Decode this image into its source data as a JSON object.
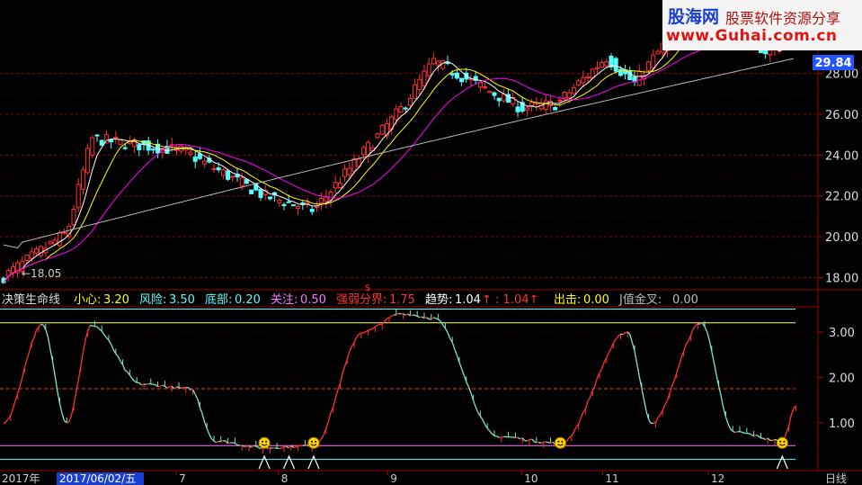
{
  "watermark": {
    "brand": "股海网",
    "tagline": "股票软件资源分享",
    "url": "www.Guhai.com.cn"
  },
  "colors": {
    "up": "#ff3232",
    "down": "#54ffff",
    "ma5": "#ffffff",
    "ma10": "#ffff00",
    "ma20": "#ff00ff",
    "ma60": "#bbbbbb",
    "axis": "#9b0000"
  },
  "chart_data": [
    {
      "type": "candlestick",
      "title": "",
      "last_price_label": "29.84",
      "low_marker_label": "←18.05",
      "y_ticks": [
        "28.00",
        "26.00",
        "24.00",
        "22.00",
        "20.00",
        "18.00"
      ],
      "ylim": [
        17.4,
        31.6
      ],
      "grid": true,
      "series_lines": [
        "ma-short",
        "ma-mid",
        "ma-long"
      ],
      "key_points": [
        {
          "date": "2017-05-15",
          "close": 18.05
        },
        {
          "date": "2017-06-02",
          "close": 20.2
        },
        {
          "date": "2017-06-09",
          "close": 24.8
        },
        {
          "date": "2017-07-05",
          "close": 24.2
        },
        {
          "date": "2017-07-28",
          "close": 22.0
        },
        {
          "date": "2017-08-11",
          "close": 21.3
        },
        {
          "date": "2017-09-05",
          "close": 26.3
        },
        {
          "date": "2017-09-14",
          "close": 28.6
        },
        {
          "date": "2017-10-09",
          "close": 26.3
        },
        {
          "date": "2017-10-19",
          "close": 26.5
        },
        {
          "date": "2017-11-02",
          "close": 28.8
        },
        {
          "date": "2017-11-10",
          "close": 27.5
        },
        {
          "date": "2017-11-24",
          "close": 30.7
        },
        {
          "date": "2017-12-08",
          "close": 30.2
        },
        {
          "date": "2017-12-18",
          "close": 29.0
        },
        {
          "date": "2017-12-26",
          "close": 29.84
        }
      ]
    },
    {
      "type": "line",
      "title": "决策生命线",
      "legend": [
        {
          "label": "小心:",
          "value": "3.20",
          "color": "#ffff00"
        },
        {
          "label": "风险:",
          "value": "3.50",
          "color": "#54ffff"
        },
        {
          "label": "底部:",
          "value": "0.20",
          "color": "#54ffff"
        },
        {
          "label": "关注:",
          "value": "0.50",
          "color": "#ff77ff"
        },
        {
          "label": "强弱分界:",
          "value": "1.75",
          "color": "#ff3232"
        },
        {
          "label": "趋势:",
          "value": "1.04",
          "color": "#ffffff",
          "extra": "↑ : 1.04↑"
        },
        {
          "label": "出击:",
          "value": "0.00",
          "color": "#ffff00"
        },
        {
          "label": "J值金叉:",
          "value": "0.00",
          "color": "#bbbbbb"
        }
      ],
      "y_ticks": [
        "3.00",
        "2.00",
        "1.00"
      ],
      "ylim": [
        -0.05,
        3.55
      ],
      "h_lines": [
        {
          "value": 3.2,
          "color": "#ffff90"
        },
        {
          "value": 3.5,
          "color": "#54ffff"
        },
        {
          "value": 0.2,
          "color": "#54ffff"
        },
        {
          "value": 0.5,
          "color": "#ff77ff"
        },
        {
          "value": 1.75,
          "color": "#ff3232",
          "dash": true
        }
      ],
      "key_points": [
        {
          "date": "2017-05-15",
          "value": 1.0
        },
        {
          "date": "2017-05-26",
          "value": 3.15
        },
        {
          "date": "2017-06-02",
          "value": 1.0
        },
        {
          "date": "2017-06-09",
          "value": 3.15
        },
        {
          "date": "2017-06-23",
          "value": 1.85
        },
        {
          "date": "2017-07-07",
          "value": 1.75
        },
        {
          "date": "2017-07-14",
          "value": 0.6
        },
        {
          "date": "2017-07-28",
          "value": 0.45
        },
        {
          "date": "2017-08-11",
          "value": 0.5
        },
        {
          "date": "2017-08-25",
          "value": 3.0
        },
        {
          "date": "2017-09-05",
          "value": 3.4
        },
        {
          "date": "2017-09-14",
          "value": 3.3
        },
        {
          "date": "2017-10-02",
          "value": 0.7
        },
        {
          "date": "2017-10-20",
          "value": 0.55
        },
        {
          "date": "2017-11-08",
          "value": 3.0
        },
        {
          "date": "2017-11-15",
          "value": 1.0
        },
        {
          "date": "2017-11-29",
          "value": 3.2
        },
        {
          "date": "2017-12-08",
          "value": 0.8
        },
        {
          "date": "2017-12-22",
          "value": 0.6
        },
        {
          "date": "2017-12-26",
          "value": 1.4
        }
      ],
      "signal_markers": [
        {
          "type": "smile",
          "date": "2017-07-28"
        },
        {
          "type": "smile",
          "date": "2017-08-11"
        },
        {
          "type": "smile",
          "date": "2017-10-20"
        },
        {
          "type": "smile",
          "date": "2017-12-22"
        }
      ],
      "triangle_markers": [
        "2017-07-28",
        "2017-08-04",
        "2017-08-11",
        "2017-12-22"
      ]
    }
  ],
  "x_axis": {
    "year_label": "2017年",
    "cursor_date": "2017/06/02/五",
    "month_labels": [
      "6",
      "7",
      "8",
      "9",
      "10",
      "11",
      "12"
    ],
    "period_label": "日线"
  }
}
